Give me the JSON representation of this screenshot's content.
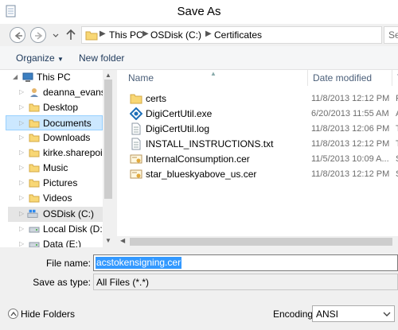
{
  "window": {
    "title": "Save As"
  },
  "address": {
    "crumbs": [
      "This PC",
      "OSDisk (C:)",
      "Certificates"
    ],
    "search_placeholder": "Se"
  },
  "toolbar": {
    "organize_label": "Organize",
    "new_folder_label": "New folder"
  },
  "nav_pane": {
    "items": [
      {
        "label": "This PC",
        "icon": "computer-icon",
        "selected": false
      },
      {
        "label": "deanna_evans@",
        "icon": "user-folder-icon",
        "selected": false
      },
      {
        "label": "Desktop",
        "icon": "folder-icon",
        "selected": false
      },
      {
        "label": "Documents",
        "icon": "folder-icon",
        "selected": true
      },
      {
        "label": "Downloads",
        "icon": "folder-icon",
        "selected": false
      },
      {
        "label": "kirke.sharepoint.",
        "icon": "folder-icon",
        "selected": false
      },
      {
        "label": "Music",
        "icon": "folder-icon",
        "selected": false
      },
      {
        "label": "Pictures",
        "icon": "folder-icon",
        "selected": false
      },
      {
        "label": "Videos",
        "icon": "folder-icon",
        "selected": false
      },
      {
        "label": "OSDisk (C:)",
        "icon": "windows-drive-icon",
        "selected": false
      },
      {
        "label": "Local Disk (D:)",
        "icon": "drive-icon",
        "selected": false
      },
      {
        "label": "Data (E:)",
        "icon": "drive-icon",
        "selected": false
      }
    ]
  },
  "file_list": {
    "columns": [
      "Name",
      "Date modified",
      "T"
    ],
    "rows": [
      {
        "name": "certs",
        "date": "11/8/2013 12:12 PM",
        "type": "F",
        "icon": "folder-icon"
      },
      {
        "name": "DigiCertUtil.exe",
        "date": "6/20/2013 11:55 AM",
        "type": "A",
        "icon": "digicert-app-icon"
      },
      {
        "name": "DigiCertUtil.log",
        "date": "11/8/2013 12:06 PM",
        "type": "T",
        "icon": "text-file-icon"
      },
      {
        "name": "INSTALL_INSTRUCTIONS.txt",
        "date": "11/8/2013 12:12 PM",
        "type": "T",
        "icon": "text-file-icon"
      },
      {
        "name": "InternalConsumption.cer",
        "date": "11/5/2013 10:09 A...",
        "type": "S",
        "icon": "certificate-icon"
      },
      {
        "name": "star_blueskyabove_us.cer",
        "date": "11/8/2013 12:12 PM",
        "type": "S",
        "icon": "certificate-icon"
      }
    ]
  },
  "form": {
    "file_name_label": "File name:",
    "file_name_value": "acstokensigning.cer",
    "save_as_type_label": "Save as type:",
    "save_as_type_value": "All Files  (*.*)"
  },
  "bottom": {
    "hide_folders_label": "Hide Folders",
    "encoding_label": "Encoding:",
    "encoding_value": "ANSI"
  }
}
